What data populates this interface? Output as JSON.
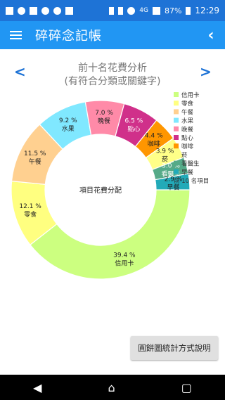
{
  "status_bar": {
    "time": "12:29",
    "battery": "87%",
    "network": "4G",
    "icons": [
      "mail-icon",
      "spotify-icon",
      "no-signal-icon",
      "play-icon",
      "g-icon",
      "image-icon",
      "bluetooth-icon",
      "vibrate-icon",
      "alarm-icon",
      "signal-icon",
      "battery-icon"
    ]
  },
  "app_bar": {
    "title": "碎碎念記帳",
    "menu_icon": "menu-icon",
    "back_icon": "chevron-left-icon"
  },
  "chart_nav": {
    "prev": "<",
    "next": ">",
    "title_line1": "前十名花費分析",
    "title_line2": "(有符合分類或關鍵字)"
  },
  "chart_data": {
    "type": "pie",
    "center_label": "項目花費分配",
    "legend_title": "前 10 名項目",
    "categories": [
      "信用卡",
      "零食",
      "午餐",
      "水果",
      "晚餐",
      "點心",
      "咖啡",
      "菸",
      "看醫生",
      "早餐"
    ],
    "values": [
      39.4,
      12.1,
      11.5,
      9.2,
      7.0,
      6.5,
      4.4,
      3.9,
      3.0,
      2.9
    ],
    "value_labels": [
      "39.4 %",
      "12.1 %",
      "11.5 %",
      "9.2 %",
      "7.0 %",
      "6.5 %",
      "4.4 %",
      "3.9 %",
      "3.0 %",
      "2.9 %"
    ],
    "colors": [
      "#ccff80",
      "#ffff80",
      "#ffd090",
      "#80e8ff",
      "#ff8aa8",
      "#d0308a",
      "#ff9600",
      "#ffff88",
      "#55aa88",
      "#22aab8"
    ]
  },
  "help_button": {
    "label": "圓餅圖統計方式說明"
  },
  "nav_bar": {
    "back": "◀",
    "home": "⌂",
    "recent": "▢"
  }
}
